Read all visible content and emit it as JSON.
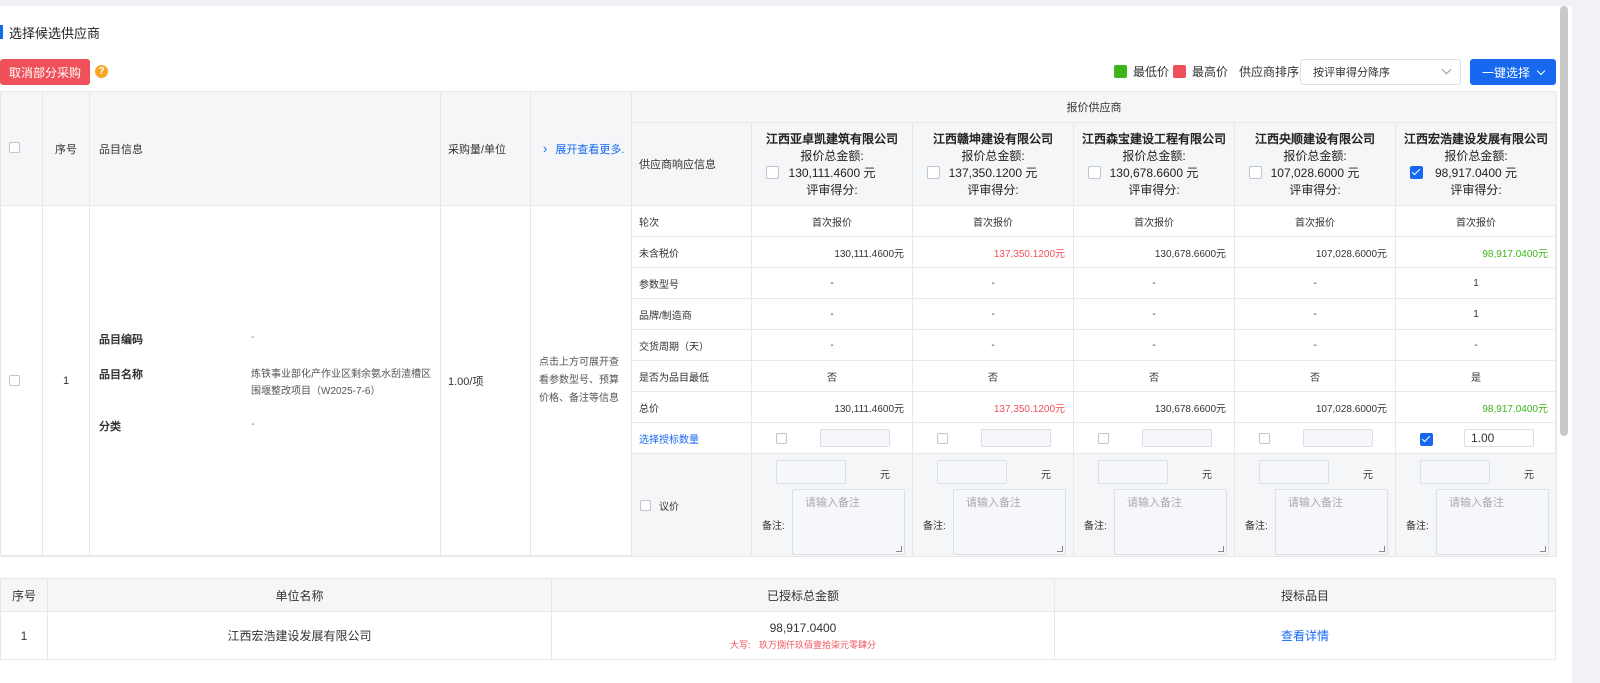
{
  "section_title": "选择候选供应商",
  "toolbar": {
    "cancel_label": "取消部分采购",
    "help": "?",
    "legend_low": "最低价",
    "legend_high": "最高价",
    "sort_label": "供应商排序",
    "sort_value": "按评审得分降序",
    "one_click_label": "一键选择",
    "colors": {
      "low": "#3cb41a",
      "high": "#f0505a",
      "accent": "#1668f0"
    }
  },
  "grid": {
    "headers": {
      "seq": "序号",
      "item_info": "品目信息",
      "qty": "采购量/单位",
      "expand": "展开查看更多...",
      "supplier_group": "报价供应商",
      "response_info": "供应商响应信息"
    },
    "quote_total_label": "报价总金额:",
    "score_label": "评审得分:",
    "suppliers": [
      {
        "name": "江西亚卓凯建筑有限公司",
        "total": "130,111.4600 元",
        "checked": false
      },
      {
        "name": "江西赣坤建设有限公司",
        "total": "137,350.1200 元",
        "checked": false
      },
      {
        "name": "江西森宝建设工程有限公司",
        "total": "130,678.6600 元",
        "checked": false
      },
      {
        "name": "江西央顺建设有限公司",
        "total": "107,028.6000 元",
        "checked": false
      },
      {
        "name": "江西宏浩建设发展有限公司",
        "total": "98,917.0400 元",
        "checked": true
      }
    ],
    "row": {
      "seq": "1",
      "code_label": "品目编码",
      "code_value": "-",
      "name_label": "品目名称",
      "name_value": "炼铁事业部化产作业区剩余氨水刮渣槽区围堰整改项目（W2025-7-6）",
      "category_label": "分类",
      "category_value": "-",
      "qty": "1.00/项",
      "expand_hint": "点击上方可展开查看参数型号、预算价格、备注等信息"
    },
    "lines": [
      {
        "label": "轮次",
        "values": [
          "首次报价",
          "首次报价",
          "首次报价",
          "首次报价",
          "首次报价"
        ],
        "align": "center"
      },
      {
        "label": "未含税价",
        "values": [
          "130,111.4600元",
          "137,350.1200元",
          "130,678.6600元",
          "107,028.6000元",
          "98,917.0400元"
        ],
        "align": "right"
      },
      {
        "label": "参数型号",
        "values": [
          "-",
          "-",
          "-",
          "-",
          "1"
        ],
        "align": "center"
      },
      {
        "label": "品牌/制造商",
        "values": [
          "-",
          "-",
          "-",
          "-",
          "1"
        ],
        "align": "center"
      },
      {
        "label": "交货周期（天）",
        "values": [
          "-",
          "-",
          "-",
          "-",
          "-"
        ],
        "align": "center"
      },
      {
        "label": "是否为品目最低",
        "values": [
          "否",
          "否",
          "否",
          "否",
          "是"
        ],
        "align": "center"
      },
      {
        "label": "总价",
        "values": [
          "130,111.4600元",
          "137,350.1200元",
          "130,678.6600元",
          "107,028.6000元",
          "98,917.0400元"
        ],
        "align": "right"
      }
    ],
    "select_qty_label": "选择授标数量",
    "select_qty_values": [
      "",
      "",
      "",
      "",
      "1.00"
    ],
    "bargain_label": "议价",
    "yuan": "元",
    "remark_label": "备注:",
    "remark_placeholder": "请输入备注"
  },
  "summary": {
    "headers": [
      "序号",
      "单位名称",
      "已授标总金额",
      "授标品目"
    ],
    "row": {
      "seq": "1",
      "unit": "江西宏浩建设发展有限公司",
      "amount": "98,917.0400",
      "capital_label": "大写:",
      "capital_value": "玖万捌仟玖佰壹拾柒元零肆分",
      "detail_link": "查看详情"
    }
  }
}
